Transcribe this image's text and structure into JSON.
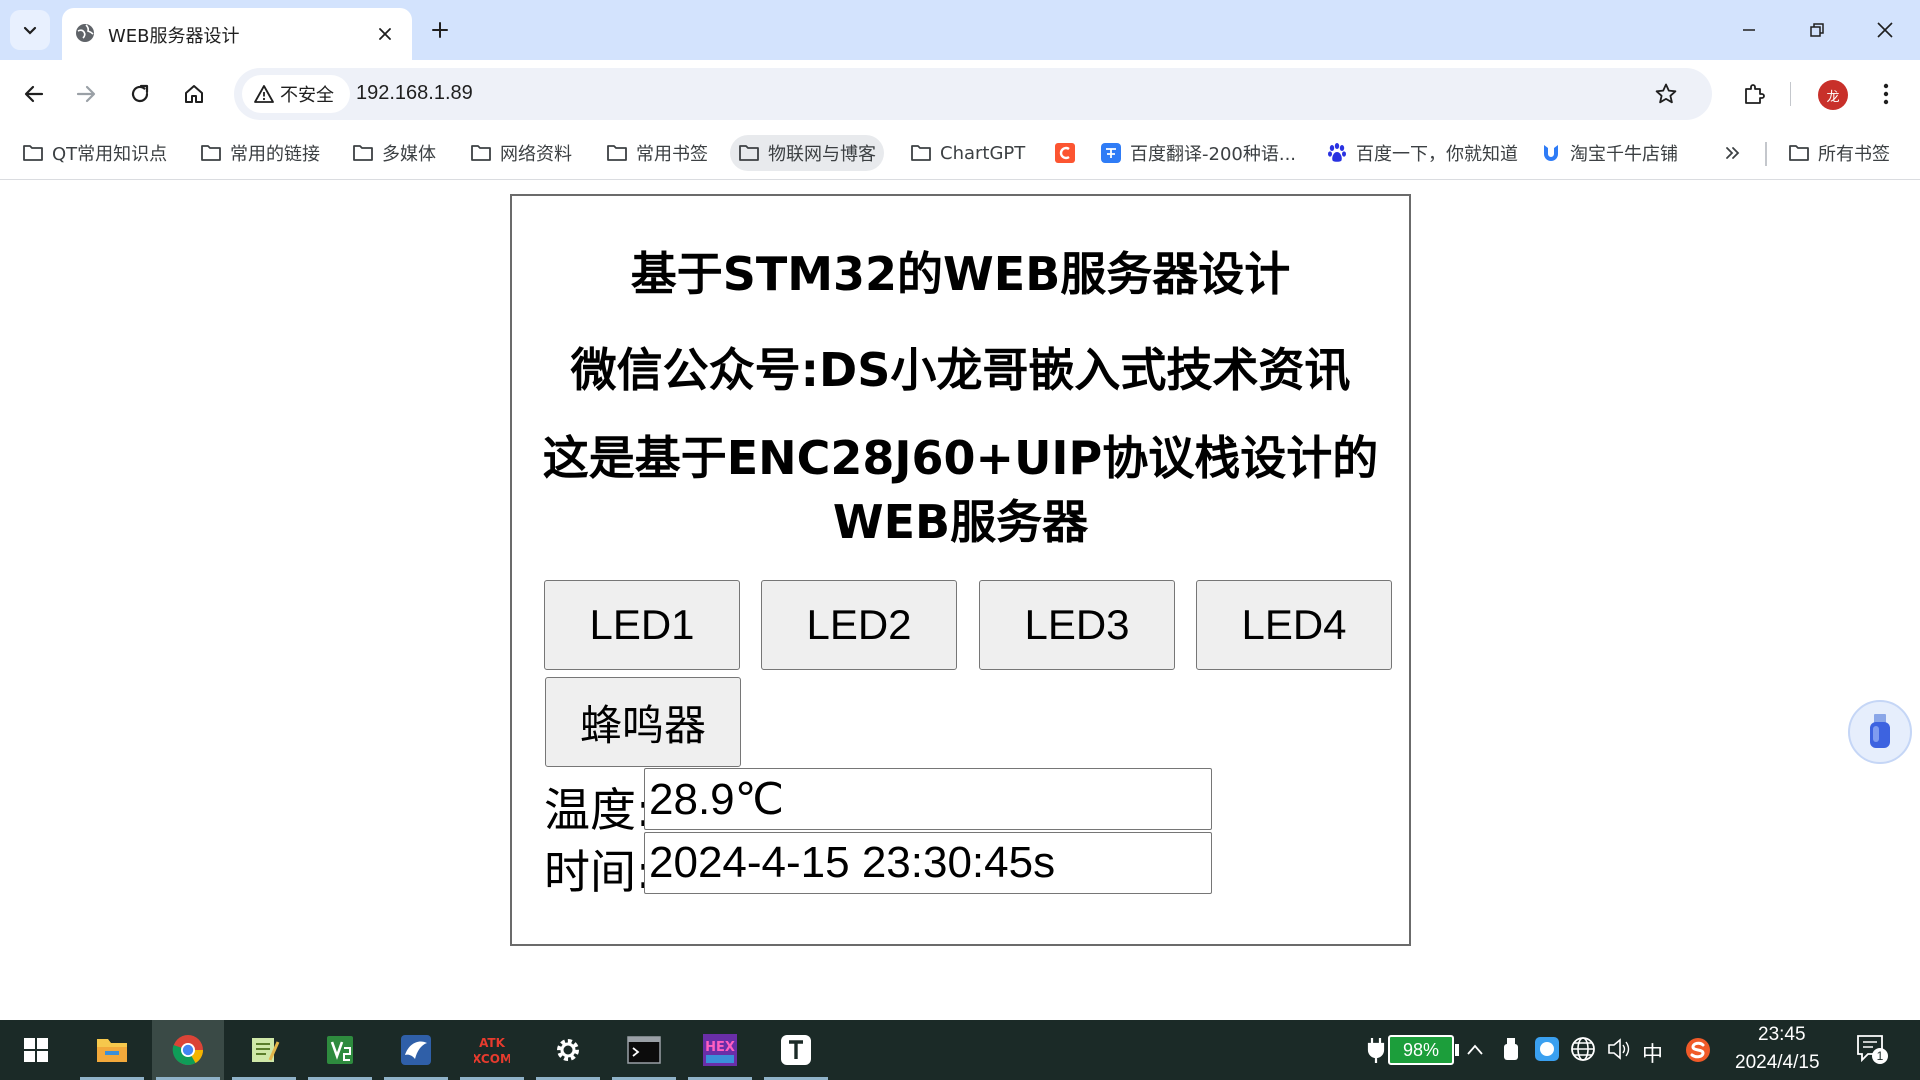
{
  "browser": {
    "tab_title": "WEB服务器设计",
    "security_label": "不安全",
    "url": "192.168.1.89",
    "profile_initial": "龙",
    "accent_color": "#d3e3fd"
  },
  "bookmarks": [
    {
      "label": "QT常用知识点",
      "icon": "folder-icon"
    },
    {
      "label": "常用的链接",
      "icon": "folder-icon"
    },
    {
      "label": "多媒体",
      "icon": "folder-icon"
    },
    {
      "label": "网络资料",
      "icon": "folder-icon"
    },
    {
      "label": "常用书签",
      "icon": "folder-icon"
    },
    {
      "label": "物联网与博客",
      "icon": "folder-icon"
    },
    {
      "label": "ChartGPT",
      "icon": "folder-icon"
    },
    {
      "label": "",
      "icon": "csdn-icon"
    },
    {
      "label": "百度翻译-200种语...",
      "icon": "translate-icon"
    },
    {
      "label": "百度一下，你就知道",
      "icon": "baidu-icon"
    },
    {
      "label": "淘宝千牛店铺",
      "icon": "qianniu-icon"
    },
    {
      "label": "所有书签",
      "icon": "folder-icon"
    }
  ],
  "page": {
    "title1": "基于STM32的WEB服务器设计",
    "title2": "微信公众号:DS小龙哥嵌入式技术资讯",
    "title3_line1": "这是基于ENC28J60+UIP协议栈设计的",
    "title3_line2": "WEB服务器",
    "buttons": {
      "led1": "LED1",
      "led2": "LED2",
      "led3": "LED3",
      "led4": "LED4",
      "buzzer": "蜂鸣器"
    },
    "temperature_label": "温度:",
    "temperature_value": "28.9℃",
    "time_label": "时间:",
    "time_value": "2024-4-15 23:30:45s"
  },
  "taskbar": {
    "battery": "98%",
    "ime": "中",
    "clock_time": "23:45",
    "clock_date": "2024/4/15",
    "notification_count": "1"
  }
}
